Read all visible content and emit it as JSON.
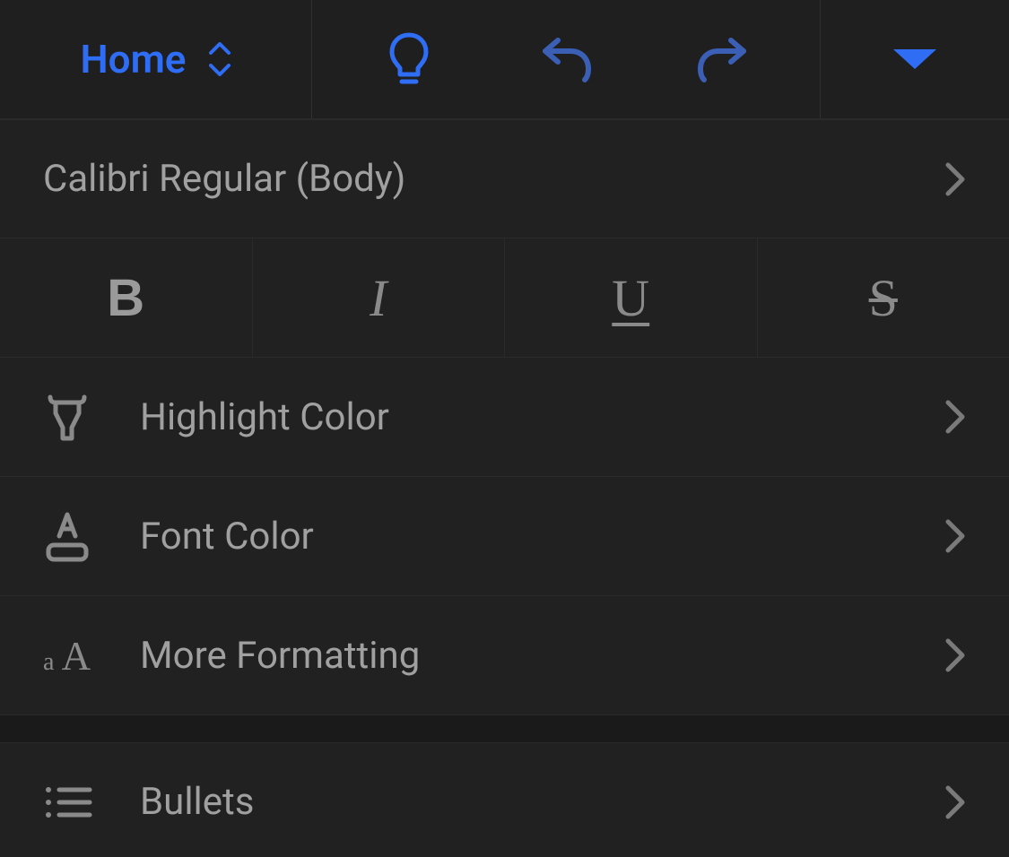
{
  "toolbar": {
    "tab_label": "Home"
  },
  "font": {
    "current": "Calibri Regular (Body)"
  },
  "styles": {
    "bold": "B",
    "italic": "I",
    "underline": "U",
    "strike": "S"
  },
  "rows": {
    "highlight": "Highlight Color",
    "fontcolor": "Font Color",
    "moreformat": "More Formatting",
    "bullets": "Bullets"
  }
}
